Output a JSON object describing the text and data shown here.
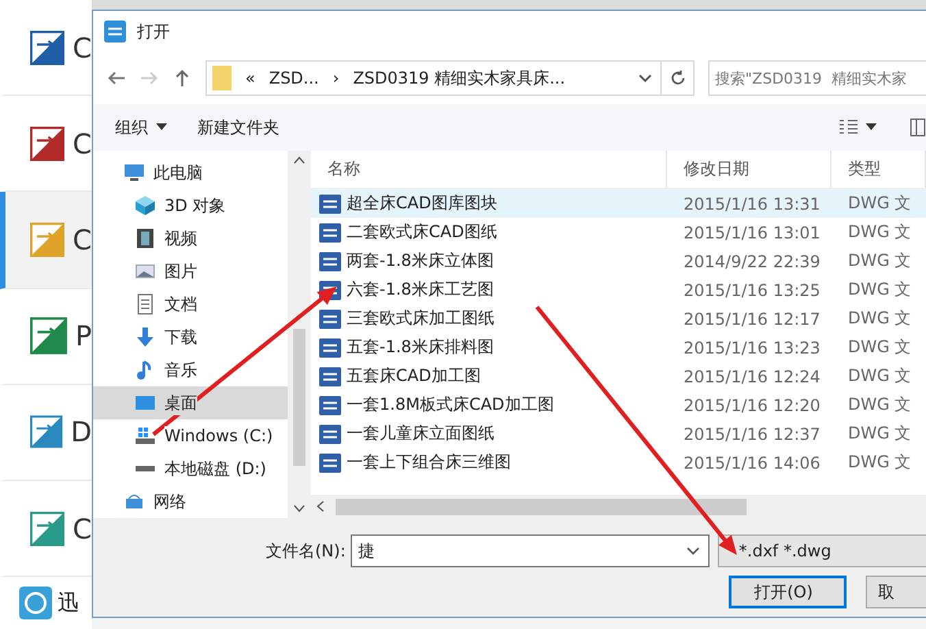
{
  "app_list": [
    {
      "label": "C",
      "kind": "convert",
      "selected": false
    },
    {
      "label": "C",
      "kind": "cad-pdf",
      "selected": false
    },
    {
      "label": "C",
      "kind": "cad-img",
      "selected": true
    },
    {
      "label": "P",
      "kind": "pdf-cad",
      "selected": false
    },
    {
      "label": "D",
      "kind": "dwg-dxf",
      "selected": false
    },
    {
      "label": "C",
      "kind": "dwg-dwf",
      "selected": false
    }
  ],
  "app_footer": {
    "label": "迅"
  },
  "dialog": {
    "title": "打开",
    "breadcrumb": [
      "«",
      "ZSD...",
      "›",
      "ZSD0319  精细实木家具床..."
    ],
    "search": {
      "placeholder": "搜索\"ZSD0319  精细实木家"
    },
    "toolbar": {
      "organize": "组织",
      "new_folder": "新建文件夹"
    },
    "nav": [
      {
        "label": "此电脑",
        "kind": "pc",
        "selected": false,
        "children": [
          {
            "label": "3D 对象",
            "kind": "cube",
            "selected": false
          },
          {
            "label": "视频",
            "kind": "film",
            "selected": false
          },
          {
            "label": "图片",
            "kind": "image",
            "selected": false
          },
          {
            "label": "文档",
            "kind": "doc",
            "selected": false
          },
          {
            "label": "下载",
            "kind": "download",
            "selected": false
          },
          {
            "label": "音乐",
            "kind": "music",
            "selected": false
          },
          {
            "label": "桌面",
            "kind": "desktop",
            "selected": true
          },
          {
            "label": "Windows (C:)",
            "kind": "sysdrive",
            "selected": false
          },
          {
            "label": "本地磁盘 (D:)",
            "kind": "drive",
            "selected": false
          }
        ]
      },
      {
        "label": "网络",
        "kind": "network",
        "selected": false
      }
    ],
    "columns": [
      "名称",
      "修改日期",
      "类型"
    ],
    "files": [
      {
        "name": "超全床CAD图库图块",
        "date": "2015/1/16 13:31",
        "type": "DWG 文",
        "selected": true
      },
      {
        "name": "二套欧式床CAD图纸",
        "date": "2015/1/16 13:01",
        "type": "DWG 文",
        "selected": false
      },
      {
        "name": "两套-1.8米床立体图",
        "date": "2014/9/22 22:39",
        "type": "DWG 文",
        "selected": false
      },
      {
        "name": "六套-1.8米床工艺图",
        "date": "2015/1/16 13:25",
        "type": "DWG 文",
        "selected": false
      },
      {
        "name": "三套欧式床加工图纸",
        "date": "2015/1/16 12:17",
        "type": "DWG 文",
        "selected": false
      },
      {
        "name": "五套-1.8米床排料图",
        "date": "2015/1/16 13:23",
        "type": "DWG 文",
        "selected": false
      },
      {
        "name": "五套床CAD加工图",
        "date": "2015/1/16 12:24",
        "type": "DWG 文",
        "selected": false
      },
      {
        "name": "一套1.8M板式床CAD加工图",
        "date": "2015/1/16 12:20",
        "type": "DWG 文",
        "selected": false
      },
      {
        "name": "一套儿童床立面图纸",
        "date": "2015/1/16 12:37",
        "type": "DWG 文",
        "selected": false
      },
      {
        "name": "一套上下组合床三维图",
        "date": "2015/1/16 14:06",
        "type": "DWG 文",
        "selected": false
      }
    ],
    "filename": {
      "label": "文件名(N):",
      "value": "捷"
    },
    "filter": "*.dxf *.dwg",
    "buttons": [
      {
        "label": "打开(O)",
        "kind": "primary"
      },
      {
        "label": "取",
        "kind": "normal"
      }
    ]
  }
}
